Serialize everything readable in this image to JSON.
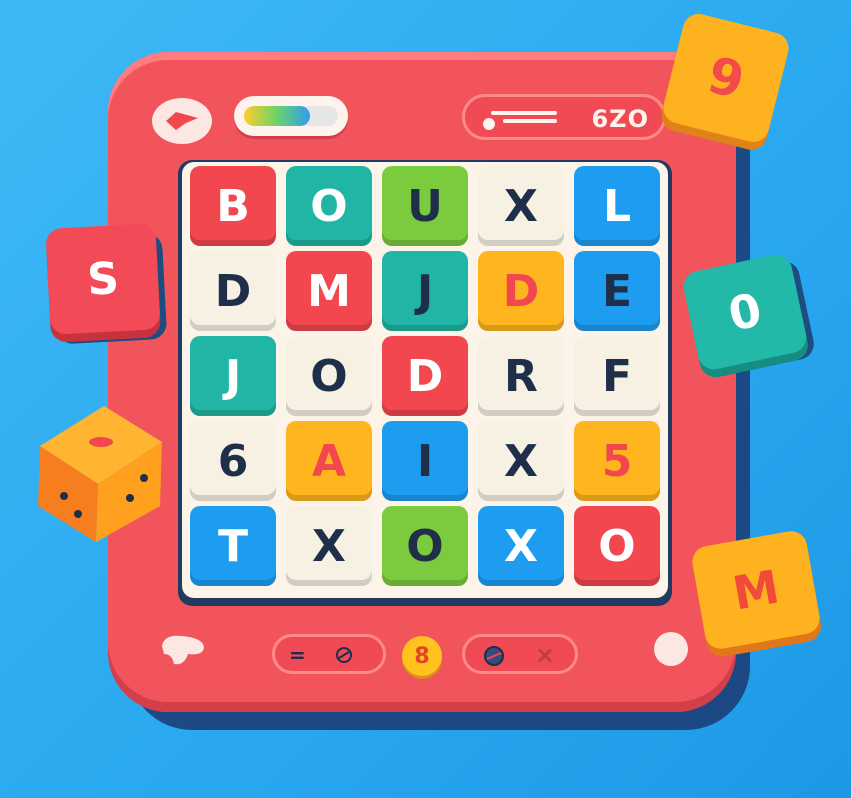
{
  "header": {
    "score": "6ZO",
    "progress_fraction": 0.7
  },
  "grid": {
    "rows": [
      [
        {
          "letter": "B",
          "bg": "#f2474f",
          "fg": "#ffffff"
        },
        {
          "letter": "O",
          "bg": "#20b5a5",
          "fg": "#ffffff"
        },
        {
          "letter": "U",
          "bg": "#7ccb3f",
          "fg": "#1f2f4a"
        },
        {
          "letter": "X",
          "bg": "#f7f1e4",
          "fg": "#1f2f4a"
        },
        {
          "letter": "L",
          "bg": "#1e9df0",
          "fg": "#ffffff"
        }
      ],
      [
        {
          "letter": "D",
          "bg": "#f7f1e4",
          "fg": "#1f2f4a"
        },
        {
          "letter": "M",
          "bg": "#f2474f",
          "fg": "#ffffff"
        },
        {
          "letter": "J",
          "bg": "#20b5a5",
          "fg": "#1f2f4a"
        },
        {
          "letter": "D",
          "bg": "#ffb51e",
          "fg": "#f2474f"
        },
        {
          "letter": "E",
          "bg": "#1e9df0",
          "fg": "#1f2f4a"
        }
      ],
      [
        {
          "letter": "J",
          "bg": "#20b5a5",
          "fg": "#ffffff"
        },
        {
          "letter": "O",
          "bg": "#f7f1e4",
          "fg": "#1f2f4a"
        },
        {
          "letter": "D",
          "bg": "#f2474f",
          "fg": "#ffffff"
        },
        {
          "letter": "R",
          "bg": "#f7f1e4",
          "fg": "#1f2f4a"
        },
        {
          "letter": "F",
          "bg": "#f7f1e4",
          "fg": "#1f2f4a"
        }
      ],
      [
        {
          "letter": "6",
          "bg": "#f7f1e4",
          "fg": "#1f2f4a"
        },
        {
          "letter": "A",
          "bg": "#ffb51e",
          "fg": "#f2474f"
        },
        {
          "letter": "I",
          "bg": "#1e9df0",
          "fg": "#1f2f4a"
        },
        {
          "letter": "X",
          "bg": "#f7f1e4",
          "fg": "#1f2f4a"
        },
        {
          "letter": "5",
          "bg": "#ffb51e",
          "fg": "#f2474f"
        }
      ],
      [
        {
          "letter": "T",
          "bg": "#1e9df0",
          "fg": "#ffffff"
        },
        {
          "letter": "X",
          "bg": "#f7f1e4",
          "fg": "#1f2f4a"
        },
        {
          "letter": "O",
          "bg": "#7ccb3f",
          "fg": "#1f2f4a"
        },
        {
          "letter": "X",
          "bg": "#1e9df0",
          "fg": "#ffffff"
        },
        {
          "letter": "O",
          "bg": "#f2474f",
          "fg": "#ffffff"
        }
      ]
    ]
  },
  "floating_tiles": {
    "s": "S",
    "nine": "9",
    "zero": "0",
    "m": "M"
  },
  "footer": {
    "left_symbol": "=",
    "coin_value": "8",
    "right_symbol": "×"
  },
  "colors": {
    "background": "#2aa9f0",
    "board": "#f2545b",
    "frame": "#203a62"
  }
}
